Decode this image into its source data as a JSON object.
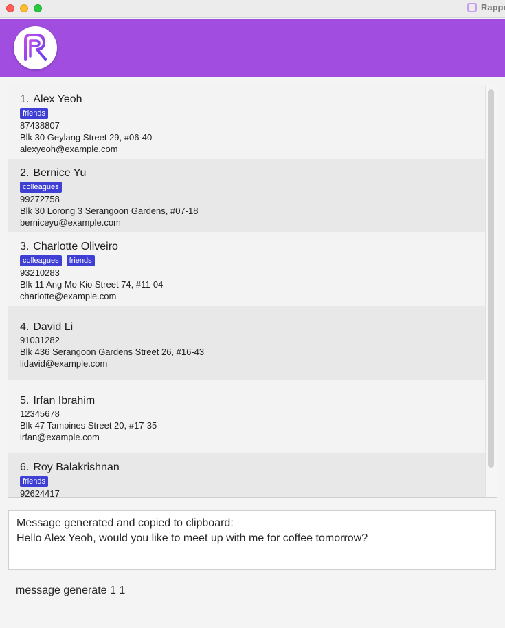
{
  "window": {
    "title": "Rappe"
  },
  "colors": {
    "header": "#a04de0",
    "tag": "#3f3fd6"
  },
  "persons": [
    {
      "index": "1.",
      "name": "Alex Yeoh",
      "tags": [
        "friends"
      ],
      "phone": "87438807",
      "address": "Blk 30 Geylang Street 29, #06-40",
      "email": "alexyeoh@example.com"
    },
    {
      "index": "2.",
      "name": "Bernice Yu",
      "tags": [
        "colleagues"
      ],
      "phone": "99272758",
      "address": "Blk 30 Lorong 3 Serangoon Gardens, #07-18",
      "email": "berniceyu@example.com"
    },
    {
      "index": "3.",
      "name": "Charlotte Oliveiro",
      "tags": [
        "colleagues",
        "friends"
      ],
      "phone": "93210283",
      "address": "Blk 11 Ang Mo Kio Street 74, #11-04",
      "email": "charlotte@example.com"
    },
    {
      "index": "4.",
      "name": "David Li",
      "tags": [],
      "phone": "91031282",
      "address": "Blk 436 Serangoon Gardens Street 26, #16-43",
      "email": "lidavid@example.com"
    },
    {
      "index": "5.",
      "name": "Irfan Ibrahim",
      "tags": [],
      "phone": "12345678",
      "address": "Blk 47 Tampines Street 20, #17-35",
      "email": "irfan@example.com"
    },
    {
      "index": "6.",
      "name": "Roy Balakrishnan",
      "tags": [
        "friends"
      ],
      "phone": "92624417",
      "address": "",
      "email": ""
    }
  ],
  "result": {
    "line1": "Message generated and copied to clipboard:",
    "line2": "Hello Alex Yeoh, would you like to meet up with me for coffee tomorrow?"
  },
  "command": {
    "value": "message generate 1 1"
  }
}
